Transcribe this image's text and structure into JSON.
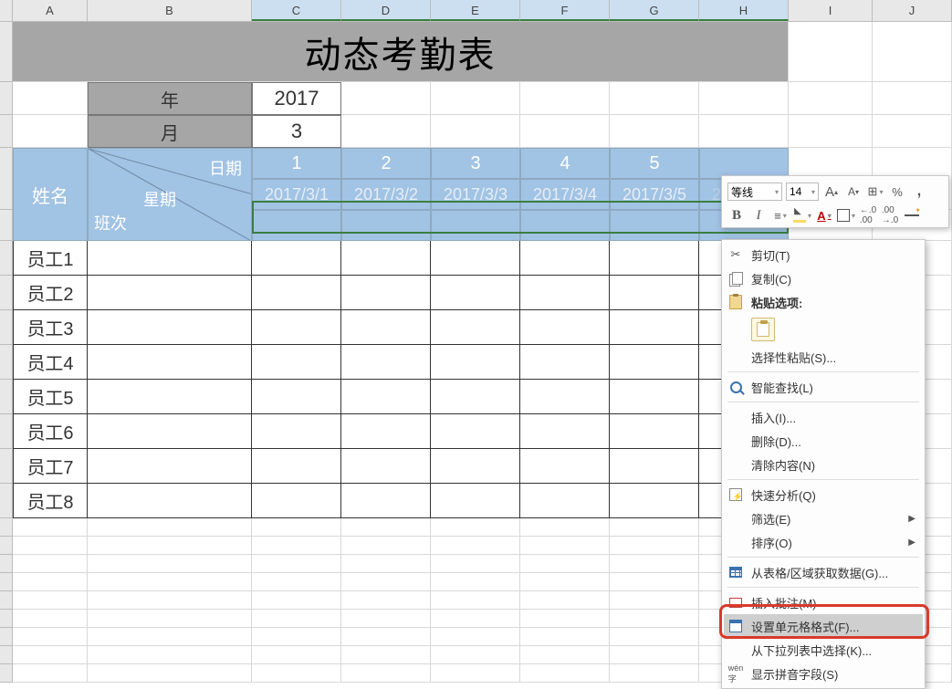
{
  "columns": [
    "A",
    "B",
    "C",
    "D",
    "E",
    "F",
    "G",
    "H",
    "I",
    "J"
  ],
  "title": "动态考勤表",
  "params": {
    "year_label": "年",
    "year_value": "2017",
    "month_label": "月",
    "month_value": "3"
  },
  "header": {
    "name": "姓名",
    "date_label": "日期",
    "weekday_label": "星期",
    "shift_label": "班次",
    "day_numbers": [
      "1",
      "2",
      "3",
      "4",
      "5",
      ""
    ],
    "dates": [
      "2017/3/1",
      "2017/3/2",
      "2017/3/3",
      "2017/3/4",
      "2017/3/5",
      "2017/3/6"
    ]
  },
  "employees": [
    "员工1",
    "员工2",
    "员工3",
    "员工4",
    "员工5",
    "员工6",
    "员工7",
    "员工8"
  ],
  "mini_toolbar": {
    "font": "等线",
    "size": "14",
    "increase_font": "A",
    "decrease_font": "A",
    "percent": "%",
    "comma": ",",
    "bold": "B",
    "italic": "I",
    "font_color": "A",
    "dec_inc": ".0",
    "dec_dec": ".00"
  },
  "context_menu": {
    "cut": "剪切(T)",
    "copy": "复制(C)",
    "paste_options": "粘贴选项:",
    "paste_special": "选择性粘贴(S)...",
    "smart_lookup": "智能查找(L)",
    "insert": "插入(I)...",
    "delete": "删除(D)...",
    "clear": "清除内容(N)",
    "quick_analysis": "快速分析(Q)",
    "filter": "筛选(E)",
    "sort": "排序(O)",
    "get_data": "从表格/区域获取数据(G)...",
    "insert_comment": "插入批注(M)",
    "format_cells": "设置单元格格式(F)...",
    "pick_from_list": "从下拉列表中选择(K)...",
    "show_pinyin": "显示拼音字段(S)"
  }
}
